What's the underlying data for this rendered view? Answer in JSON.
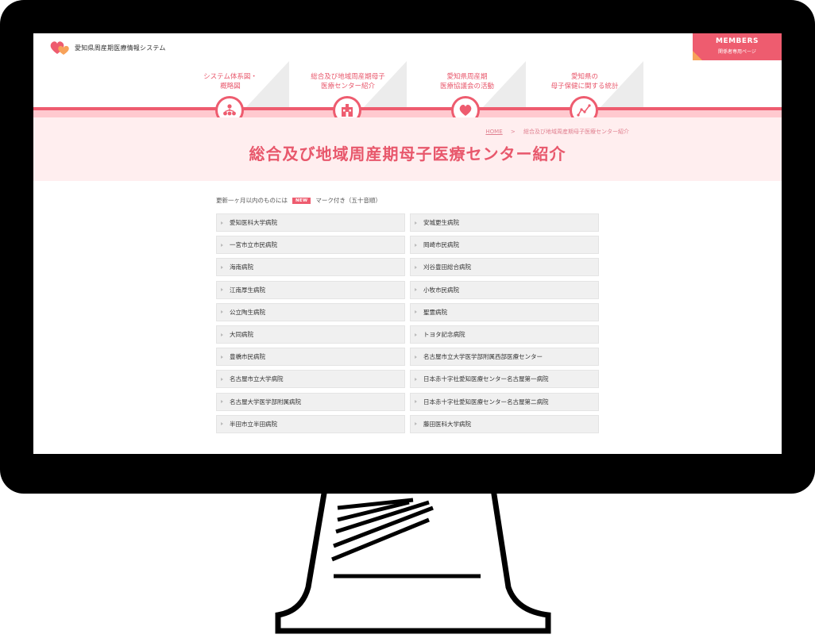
{
  "header": {
    "site_name": "愛知県周産期医療情報システム",
    "members_title": "MEMBERS",
    "members_sub": "関係者専用ページ"
  },
  "nav": [
    {
      "label": "システム体系図・\n概略図",
      "icon": "people-network-icon"
    },
    {
      "label": "総合及び地域周産期母子\n医療センター紹介",
      "icon": "hospital-building-icon"
    },
    {
      "label": "愛知県周産期\n医療協議会の活動",
      "icon": "heart-icon"
    },
    {
      "label": "愛知県の\n母子保健に関する統計",
      "icon": "line-graph-icon"
    }
  ],
  "breadcrumb": {
    "home": "HOME",
    "separator": ">",
    "current": "総合及び地域周産期母子医療センター紹介"
  },
  "page_title": "総合及び地域周産期母子医療センター紹介",
  "notice": {
    "before": "更新一ヶ月以内のものには",
    "badge": "NEW",
    "after": "マーク付き（五十音順）"
  },
  "hospitals": [
    "愛知医科大学病院",
    "安城更生病院",
    "一宮市立市民病院",
    "岡崎市民病院",
    "海南病院",
    "刈谷豊田総合病院",
    "江南厚生病院",
    "小牧市民病院",
    "公立陶生病院",
    "聖霊病院",
    "大同病院",
    "トヨタ記念病院",
    "豊橋市民病院",
    "名古屋市立大学医学部附属西部医療センター",
    "名古屋市立大学病院",
    "日本赤十字社愛知医療センター名古屋第一病院",
    "名古屋大学医学部附属病院",
    "日本赤十字社愛知医療センター名古屋第二病院",
    "半田市立半田病院",
    "藤田医科大学病院"
  ],
  "colors": {
    "accent": "#ee5c6f",
    "accent_light": "#ffc9cf",
    "hero_bg": "#ffeeef",
    "members_corner": "#f7a25a"
  }
}
